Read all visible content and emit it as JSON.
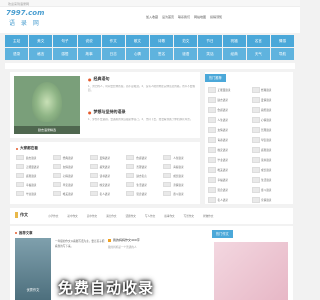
{
  "topbar": {
    "welcome": "欢迎来到语录网"
  },
  "header": {
    "site": "7997.com",
    "name": "语 录 网",
    "links": [
      "加入收藏",
      "设为首页",
      "联系我们",
      "网站地图",
      "投稿须知"
    ]
  },
  "nav": {
    "row1": [
      "主站",
      "美文",
      "句子",
      "说说",
      "作文",
      "散文",
      "诗歌",
      "范文",
      "节日",
      "祝福",
      "名言",
      "情感"
    ],
    "row2": [
      "语录",
      "格言",
      "感悟",
      "故事",
      "日志",
      "心情",
      "签名",
      "谜语",
      "笑话",
      "经典",
      "天气",
      "导航"
    ]
  },
  "featured": {
    "caption": "励志语录精选",
    "art1": {
      "title": "经典语句",
      "desc": "1、努力的人，时间会给你答案，而不是眼泪。2、没有人能替你走完你该走的路，所以不要抱怨。"
    },
    "art2": {
      "title": "梦想与坚持的语录",
      "desc": "1、梦想不会逃跑，会逃跑的永远都是你自己。2、坚持下去，终会看到属于你的那片风景。"
    }
  },
  "tags": {
    "title": "大家都在看",
    "items": [
      "励志语录",
      "经典语录",
      "爱情语录",
      "伤感语录",
      "人生语录",
      "正能量语录",
      "友情语录",
      "搞笑语录",
      "哲理语录",
      "青春语录",
      "感恩语录",
      "心情语录",
      "读书语录",
      "励志名言",
      "成长语录",
      "幸福语录",
      "早安语录",
      "晚安语录",
      "生活语录",
      "亲情语录",
      "毕业语录",
      "唯美语录",
      "名人语录",
      "思念语录",
      "奋斗语录"
    ]
  },
  "side": {
    "tab": "热门推荐",
    "items": [
      "正能量语录",
      "经典语录",
      "励志语录",
      "爱情语录",
      "伤感语录",
      "搞笑语录",
      "人生语录",
      "心情语录",
      "友情语录",
      "哲理语录",
      "青春语录",
      "早安语录",
      "晚安语录",
      "感恩语录",
      "毕业语录",
      "读书语录",
      "唯美语录",
      "成长语录",
      "幸福语录",
      "生活语录",
      "思念语录",
      "奋斗语录",
      "名人语录",
      "亲情语录"
    ]
  },
  "zuowen": {
    "title": "作文",
    "links": [
      "小学作文",
      "初中作文",
      "高中作文",
      "满分作文",
      "话题作文",
      "写人作文",
      "叙事作文",
      "写景作文",
      "状物作文"
    ],
    "rec": "推荐文章",
    "thumb_cap": "优秀作文",
    "text": "一年级的作文以看图写话为主，要让孩子把看到的写下来。",
    "mid_title": "我的妈妈作文400字",
    "mid_desc": "我的妈妈是一个普通的人",
    "right_tab": "热门作文"
  },
  "promo": "免费自动收录"
}
